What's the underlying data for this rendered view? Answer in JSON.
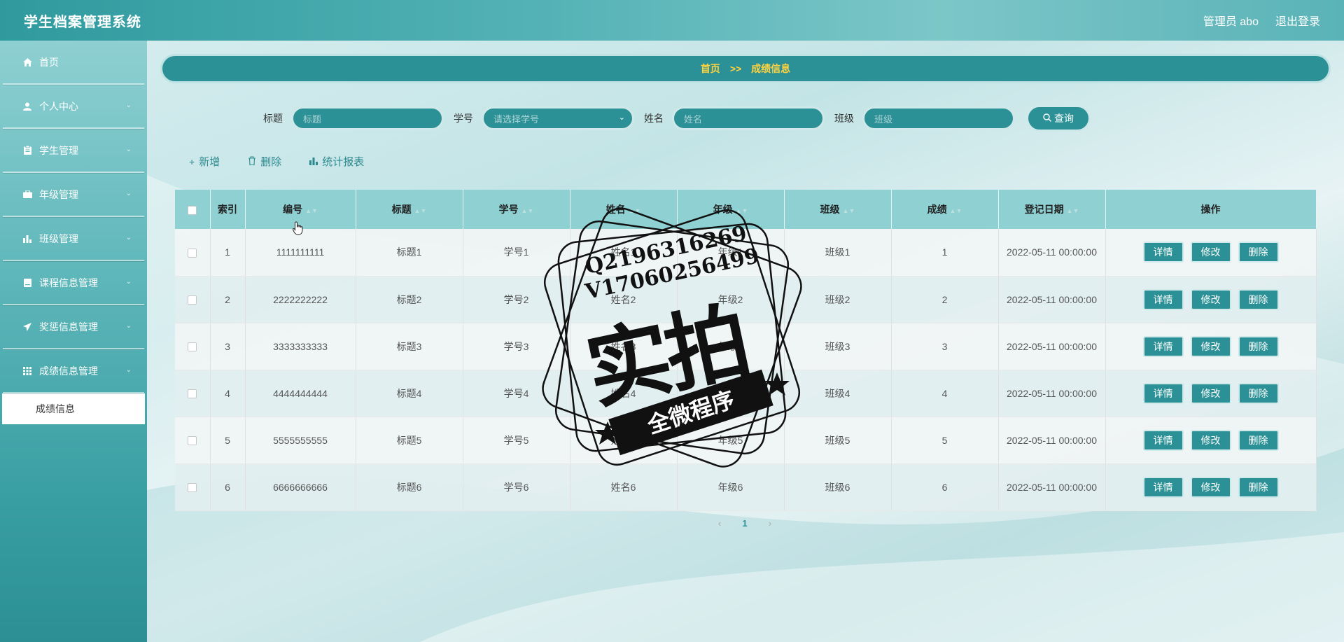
{
  "header": {
    "app_title": "学生档案管理系统",
    "user_label": "管理员 abo",
    "logout_label": "退出登录"
  },
  "sidebar": {
    "items": [
      {
        "label": "首页",
        "icon": "home-icon",
        "has_children": false
      },
      {
        "label": "个人中心",
        "icon": "user-icon",
        "has_children": true
      },
      {
        "label": "学生管理",
        "icon": "clipboard-icon",
        "has_children": true
      },
      {
        "label": "年级管理",
        "icon": "briefcase-icon",
        "has_children": true
      },
      {
        "label": "班级管理",
        "icon": "bar-chart-icon",
        "has_children": true
      },
      {
        "label": "课程信息管理",
        "icon": "book-icon",
        "has_children": true
      },
      {
        "label": "奖惩信息管理",
        "icon": "send-icon",
        "has_children": true
      },
      {
        "label": "成绩信息管理",
        "icon": "grid-icon",
        "has_children": true
      }
    ],
    "active_submenu": "成绩信息"
  },
  "breadcrumb": {
    "home": "首页",
    "separator": ">>",
    "current": "成绩信息"
  },
  "search": {
    "title_label": "标题",
    "title_placeholder": "标题",
    "student_no_label": "学号",
    "student_no_placeholder": "请选择学号",
    "name_label": "姓名",
    "name_placeholder": "姓名",
    "class_label": "班级",
    "class_placeholder": "班级",
    "query_label": "查询"
  },
  "actions": {
    "add_label": "新增",
    "delete_label": "删除",
    "report_label": "统计报表"
  },
  "table": {
    "columns": [
      "索引",
      "编号",
      "标题",
      "学号",
      "姓名",
      "年级",
      "班级",
      "成绩",
      "登记日期",
      "操作"
    ],
    "rows": [
      {
        "index": "1",
        "code": "1111111111",
        "title": "标题1",
        "student_no": "学号1",
        "name": "姓名1",
        "grade": "年级1",
        "class": "班级1",
        "score": "1",
        "date": "2022-05-11 00:00:00"
      },
      {
        "index": "2",
        "code": "2222222222",
        "title": "标题2",
        "student_no": "学号2",
        "name": "姓名2",
        "grade": "年级2",
        "class": "班级2",
        "score": "2",
        "date": "2022-05-11 00:00:00"
      },
      {
        "index": "3",
        "code": "3333333333",
        "title": "标题3",
        "student_no": "学号3",
        "name": "姓名3",
        "grade": "年级3",
        "class": "班级3",
        "score": "3",
        "date": "2022-05-11 00:00:00"
      },
      {
        "index": "4",
        "code": "4444444444",
        "title": "标题4",
        "student_no": "学号4",
        "name": "姓名4",
        "grade": "年级4",
        "class": "班级4",
        "score": "4",
        "date": "2022-05-11 00:00:00"
      },
      {
        "index": "5",
        "code": "5555555555",
        "title": "标题5",
        "student_no": "学号5",
        "name": "姓名5",
        "grade": "年级5",
        "class": "班级5",
        "score": "5",
        "date": "2022-05-11 00:00:00"
      },
      {
        "index": "6",
        "code": "6666666666",
        "title": "标题6",
        "student_no": "学号6",
        "name": "姓名6",
        "grade": "年级6",
        "class": "班级6",
        "score": "6",
        "date": "2022-05-11 00:00:00"
      }
    ],
    "op_detail": "详情",
    "op_edit": "修改",
    "op_delete": "删除"
  },
  "pagination": {
    "current_page": "1"
  },
  "watermark": {
    "line1": "Q2196316269",
    "line2": "V17060256499",
    "big": "实拍",
    "ribbon": "全微程序"
  },
  "colors": {
    "primary": "#2c9196",
    "accent_text": "#ffd23f",
    "header_bg": "#8fd0d3"
  }
}
